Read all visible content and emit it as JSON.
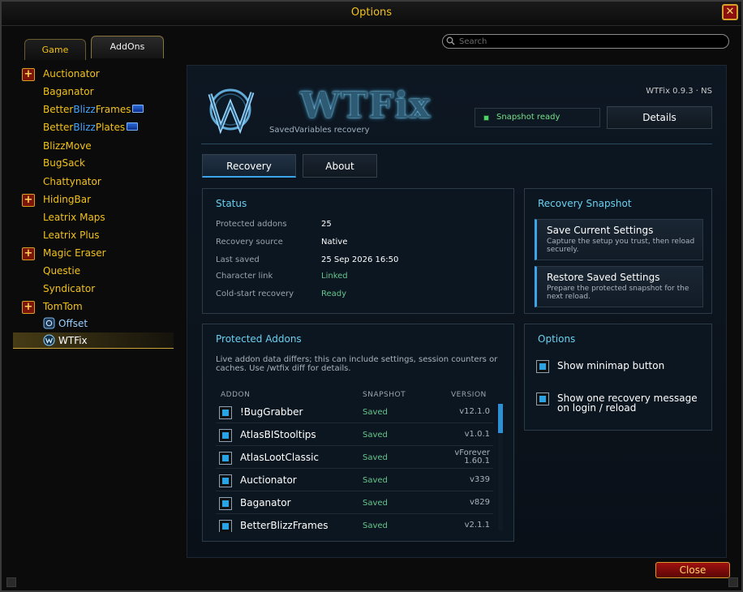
{
  "window": {
    "title": "Options",
    "close_label": "✕"
  },
  "top_tabs": {
    "game": "Game",
    "addons": "AddOns"
  },
  "search": {
    "placeholder": "Search"
  },
  "sidebar": {
    "items": [
      {
        "label": "Auctionator",
        "expandable": true
      },
      {
        "label": "Baganator"
      },
      {
        "label_pre": "Better",
        "label_blz": "Blizz",
        "label_post": "Frames"
      },
      {
        "label_pre": "Better",
        "label_blz": "Blizz",
        "label_post": "Plates"
      },
      {
        "label": "BlizzMove"
      },
      {
        "label": "BugSack"
      },
      {
        "label": "Chattynator"
      },
      {
        "label": "HidingBar",
        "expandable": true
      },
      {
        "label": "Leatrix Maps"
      },
      {
        "label": "Leatrix Plus"
      },
      {
        "label": "Magic Eraser",
        "expandable": true
      },
      {
        "label": "Questie"
      },
      {
        "label": "Syndicator"
      },
      {
        "label": "TomTom",
        "expandable": true
      },
      {
        "label": "Offset",
        "child": true
      },
      {
        "label": "WTFix",
        "child": true,
        "selected": true
      }
    ]
  },
  "header": {
    "logo_text": "WTFix",
    "subtitle": "SavedVariables recovery",
    "version": "WTFix 0.9.3 · NS",
    "snapshot_status": "Snapshot ready",
    "details_label": "Details"
  },
  "tabs": {
    "recovery": "Recovery",
    "about": "About"
  },
  "status": {
    "title": "Status",
    "rows": [
      {
        "key": "Protected addons",
        "value": "25"
      },
      {
        "key": "Recovery source",
        "value": "Native"
      },
      {
        "key": "Last saved",
        "value": "25 Sep 2026 16:50"
      },
      {
        "key": "Character link",
        "value": "Linked"
      },
      {
        "key": "Cold-start recovery",
        "value": "Ready"
      }
    ]
  },
  "recovery_snapshot": {
    "title": "Recovery Snapshot",
    "save": {
      "title": "Save Current Settings",
      "desc": "Capture the setup you trust, then reload securely."
    },
    "restore": {
      "title": "Restore Saved Settings",
      "desc": "Prepare the protected snapshot for the next reload."
    }
  },
  "protected": {
    "title": "Protected Addons",
    "desc": "Live addon data differs; this can include settings, session counters or caches. Use /wtfix diff for details.",
    "columns": {
      "addon": "ADDON",
      "snapshot": "SNAPSHOT",
      "version": "VERSION"
    },
    "rows": [
      {
        "name": "!BugGrabber",
        "snapshot": "Saved",
        "version": "v12.1.0"
      },
      {
        "name": "AtlasBIStooltips",
        "snapshot": "Saved",
        "version": "v1.0.1"
      },
      {
        "name": "AtlasLootClassic",
        "snapshot": "Saved",
        "version": "vForever",
        "version2": "1.60.1"
      },
      {
        "name": "Auctionator",
        "snapshot": "Saved",
        "version": "v339"
      },
      {
        "name": "Baganator",
        "snapshot": "Saved",
        "version": "v829"
      },
      {
        "name": "BetterBlizzFrames",
        "snapshot": "Saved",
        "version": "v2.1.1"
      }
    ]
  },
  "options": {
    "title": "Options",
    "minimap": "Show minimap button",
    "recovery_msg_line1": "Show one recovery message",
    "recovery_msg_line2": "on login / reload"
  },
  "footer": {
    "close_label": "Close"
  },
  "colors": {
    "accent": "#3aa5ea",
    "gold": "#f2c21a",
    "green": "#66c78c"
  }
}
